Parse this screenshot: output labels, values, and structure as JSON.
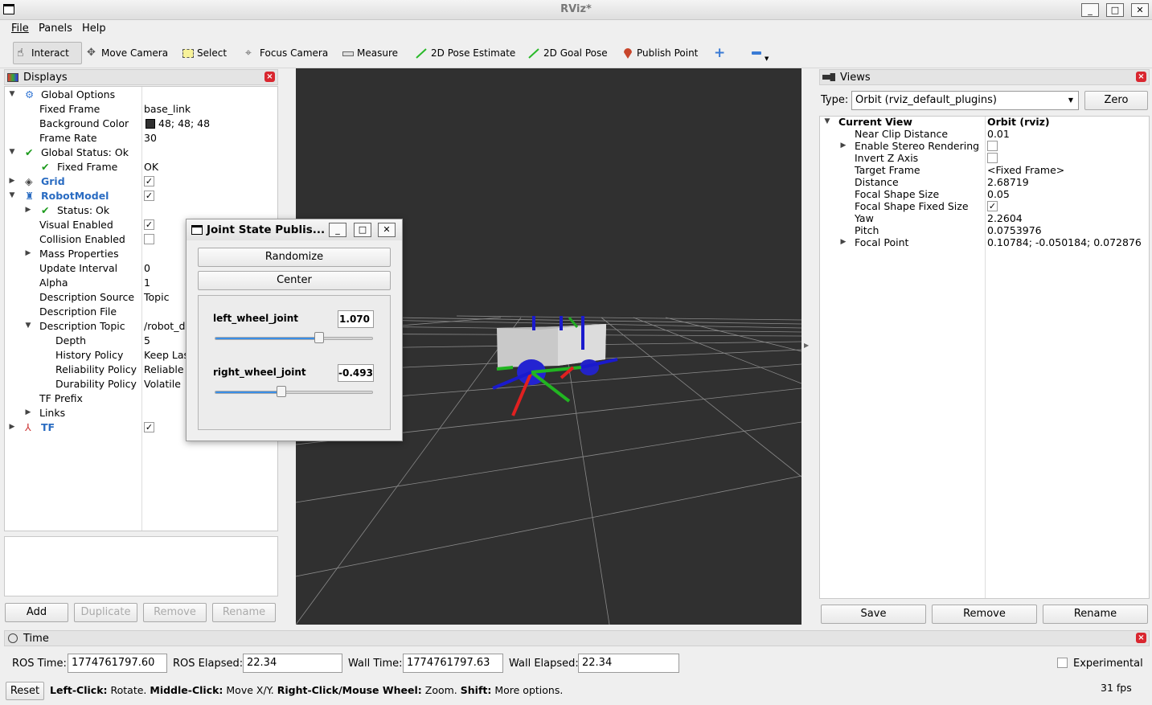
{
  "window": {
    "title": "RViz*"
  },
  "menu": [
    "File",
    "Panels",
    "Help"
  ],
  "toolbar": {
    "interact": "Interact",
    "move_camera": "Move Camera",
    "select": "Select",
    "focus_camera": "Focus Camera",
    "measure": "Measure",
    "pose_estimate": "2D Pose Estimate",
    "goal_pose": "2D Goal Pose",
    "publish_point": "Publish Point"
  },
  "displays": {
    "title": "Displays",
    "rows": [
      {
        "label": "Global Options",
        "value": ""
      },
      {
        "label": "Fixed Frame",
        "value": "base_link"
      },
      {
        "label": "Background Color",
        "value": "48; 48; 48"
      },
      {
        "label": "Frame Rate",
        "value": "30"
      },
      {
        "label": "Global Status: Ok",
        "value": ""
      },
      {
        "label": "Fixed Frame",
        "value": "OK"
      },
      {
        "label": "Grid",
        "value": ""
      },
      {
        "label": "RobotModel",
        "value": ""
      },
      {
        "label": "Status: Ok",
        "value": ""
      },
      {
        "label": "Visual Enabled",
        "value": ""
      },
      {
        "label": "Collision Enabled",
        "value": ""
      },
      {
        "label": "Mass Properties",
        "value": ""
      },
      {
        "label": "Update Interval",
        "value": "0"
      },
      {
        "label": "Alpha",
        "value": "1"
      },
      {
        "label": "Description Source",
        "value": "Topic"
      },
      {
        "label": "Description File",
        "value": ""
      },
      {
        "label": "Description Topic",
        "value": "/robot_de"
      },
      {
        "label": "Depth",
        "value": "5"
      },
      {
        "label": "History Policy",
        "value": "Keep Las"
      },
      {
        "label": "Reliability Policy",
        "value": "Reliable"
      },
      {
        "label": "Durability Policy",
        "value": "Volatile"
      },
      {
        "label": "TF Prefix",
        "value": ""
      },
      {
        "label": "Links",
        "value": ""
      },
      {
        "label": "TF",
        "value": ""
      }
    ],
    "buttons": {
      "add": "Add",
      "duplicate": "Duplicate",
      "remove": "Remove",
      "rename": "Rename"
    }
  },
  "jsp": {
    "title": "Joint State Publis...",
    "randomize": "Randomize",
    "center": "Center",
    "joints": [
      {
        "name": "left_wheel_joint",
        "value": "1.070",
        "level": 0.66
      },
      {
        "name": "right_wheel_joint",
        "value": "-0.493",
        "level": 0.42
      }
    ]
  },
  "views": {
    "title": "Views",
    "type_label": "Type:",
    "type_value": "Orbit (rviz_default_plugins)",
    "zero": "Zero",
    "current": "Current View",
    "current_value": "Orbit (rviz)",
    "rows": [
      {
        "label": "Near Clip Distance",
        "value": "0.01"
      },
      {
        "label": "Enable Stereo Rendering",
        "value": ""
      },
      {
        "label": "Invert Z Axis",
        "value": ""
      },
      {
        "label": "Target Frame",
        "value": "<Fixed Frame>"
      },
      {
        "label": "Distance",
        "value": "2.68719"
      },
      {
        "label": "Focal Shape Size",
        "value": "0.05"
      },
      {
        "label": "Focal Shape Fixed Size",
        "value": ""
      },
      {
        "label": "Yaw",
        "value": "2.2604"
      },
      {
        "label": "Pitch",
        "value": "0.0753976"
      },
      {
        "label": "Focal Point",
        "value": "0.10784; -0.050184; 0.072876"
      }
    ],
    "buttons": {
      "save": "Save",
      "remove": "Remove",
      "rename": "Rename"
    }
  },
  "time": {
    "title": "Time",
    "ros_time_label": "ROS Time:",
    "ros_time": "1774761797.60",
    "ros_elapsed_label": "ROS Elapsed:",
    "ros_elapsed": "22.34",
    "wall_time_label": "Wall Time:",
    "wall_time": "1774761797.63",
    "wall_elapsed_label": "Wall Elapsed:",
    "wall_elapsed": "22.34",
    "experimental": "Experimental"
  },
  "status": {
    "reset": "Reset",
    "h1": "Left-Click:",
    "t1": " Rotate. ",
    "h2": "Middle-Click:",
    "t2": " Move X/Y. ",
    "h3": "Right-Click/Mouse Wheel:",
    "t3": " Zoom. ",
    "h4": "Shift:",
    "t4": " More options.",
    "fps": "31 fps"
  },
  "colors": {
    "viewport_bg": "#303030",
    "accent": "#2a6cc2"
  }
}
